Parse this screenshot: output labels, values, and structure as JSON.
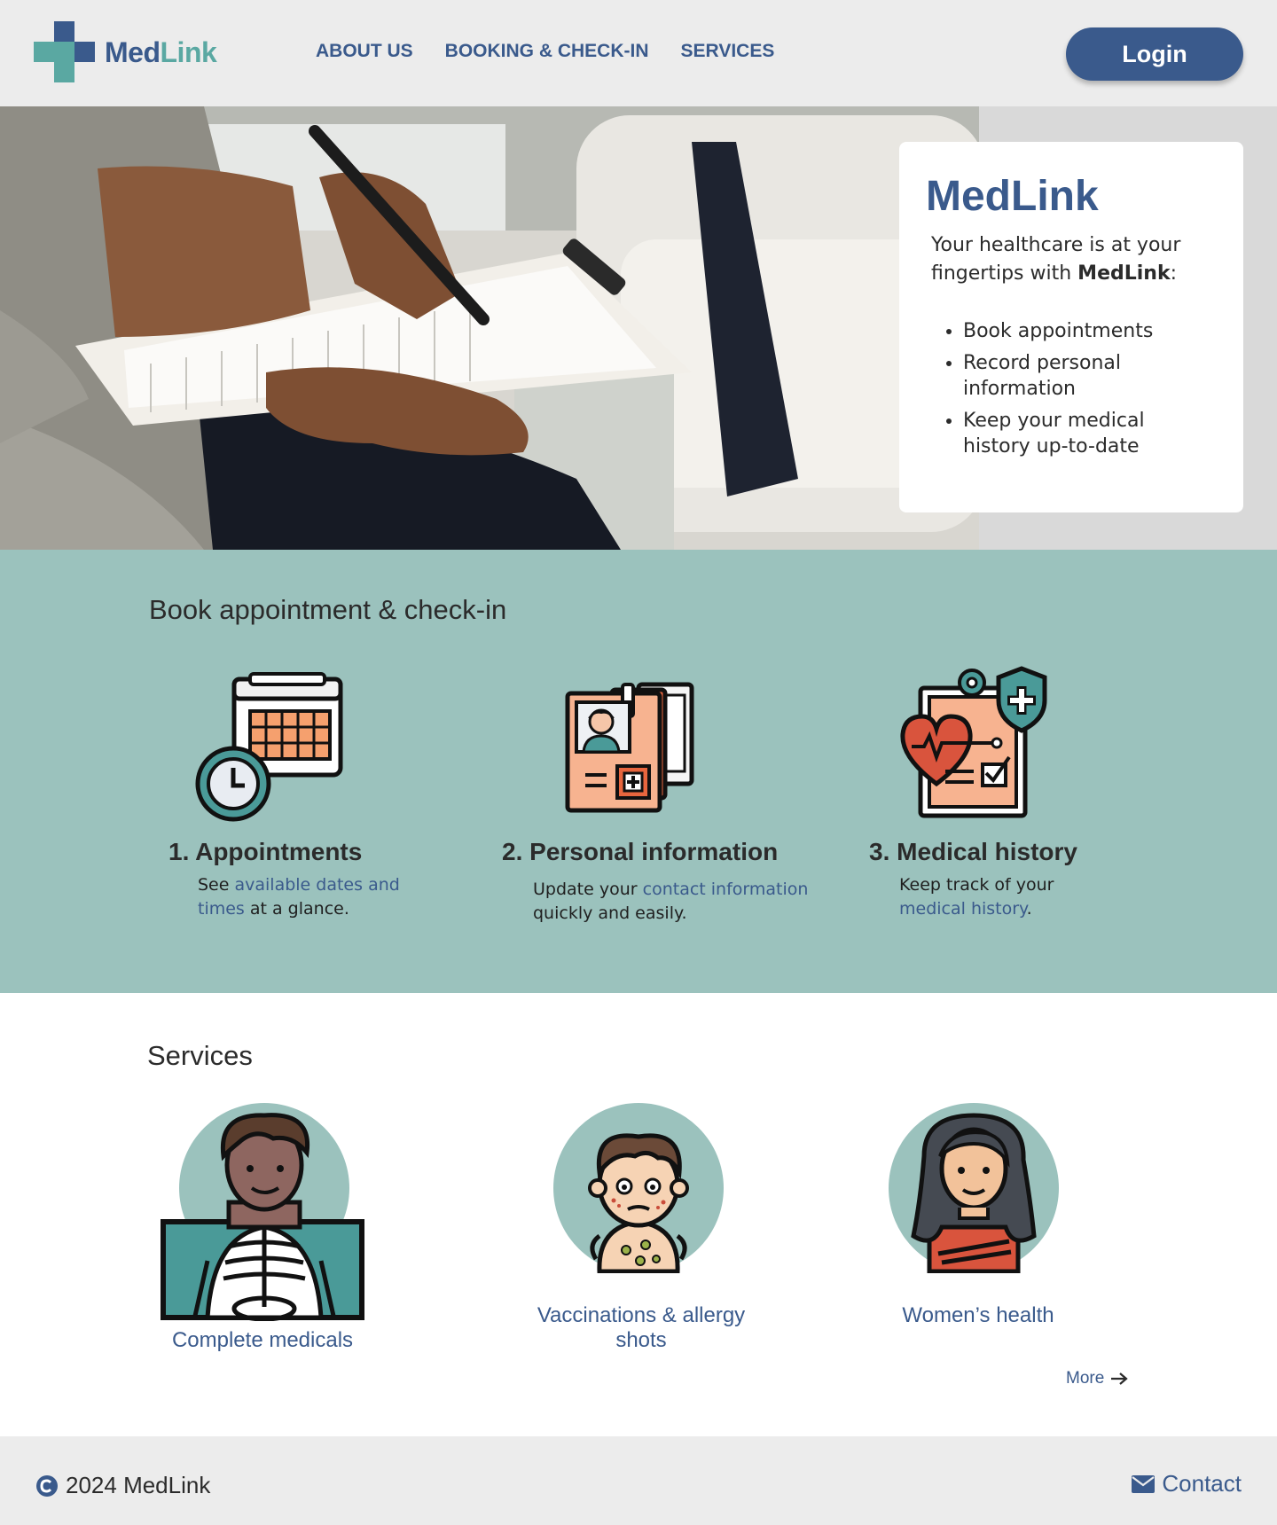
{
  "brand": {
    "name_part1": "Med",
    "name_part2": "Link",
    "accent": "#3a5a8c",
    "teal": "#5aa8a2"
  },
  "nav": {
    "items": [
      {
        "label": "ABOUT US"
      },
      {
        "label": "BOOKING & CHECK-IN"
      },
      {
        "label": "SERVICES"
      }
    ]
  },
  "header": {
    "login_label": "Login"
  },
  "hero": {
    "title": "MedLink",
    "text_before": "Your healthcare is at your fingertips with ",
    "text_bold": "MedLink",
    "text_after": ":",
    "list": [
      "Book appointments",
      "Record personal information",
      "Keep your medical history up-to-date"
    ]
  },
  "booking": {
    "title": "Book appointment & check-in",
    "steps": [
      {
        "number": "1.",
        "title": "Appointments",
        "text_before": "See ",
        "link": "available dates and times",
        "text_after": " at a glance.",
        "icon": "calendar-clock-icon"
      },
      {
        "number": "2.",
        "title": "Personal information",
        "text_before": "Update your ",
        "link": "contact information",
        "text_after": " quickly and easily.",
        "icon": "id-documents-icon"
      },
      {
        "number": "3.",
        "title": "Medical history",
        "text_before": "Keep track of your ",
        "link": "medical history",
        "text_after": ".",
        "icon": "medical-record-icon"
      }
    ]
  },
  "services": {
    "title": "Services",
    "items": [
      {
        "label": "Complete medicals",
        "icon": "xray-icon"
      },
      {
        "label": "Vaccinations & allergy shots",
        "icon": "child-allergy-icon"
      },
      {
        "label": "Women’s health",
        "icon": "woman-icon"
      }
    ],
    "more_label": "More"
  },
  "footer": {
    "copyright": "2024 MedLink",
    "contact_label": "Contact"
  }
}
